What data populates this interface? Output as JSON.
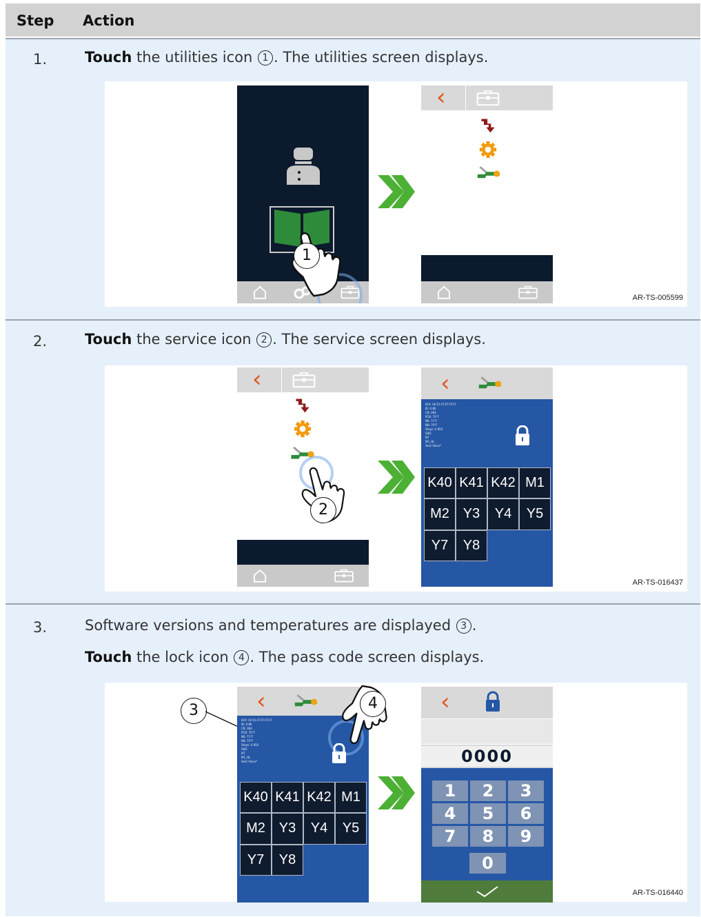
{
  "header": {
    "step": "Step",
    "action": "Action"
  },
  "steps": [
    {
      "number": "1.",
      "action_bold": "Touch",
      "action_text": "the utilities icon",
      "callout": "1",
      "action_rest": ". The utilities screen displays.",
      "ref": "AR-TS-005599"
    },
    {
      "number": "2.",
      "action_bold": "Touch",
      "action_text": "the service icon",
      "callout": "2",
      "action_rest": ". The service screen displays.",
      "ref": "AR-TS-016437"
    },
    {
      "number": "3.",
      "line1_text": "Software versions and temperatures are displayed",
      "line1_callout": "3",
      "line1_rest": ".",
      "action_bold": "Touch",
      "action_text": "the lock icon",
      "callout": "4",
      "action_rest": ". The pass code screen displays.",
      "ref": "AR-TS-016440"
    }
  ],
  "service_screen": {
    "info_text": "ID#: 0A:51:FF:FF:FF:FF\nIB: 0.86\nCB: 084\nPCB: 70°F\nN6: 71°F\nN8: 70°F\nSteps: 0 850\nSW1\nN7\nM1_HL\nVent Valve*",
    "buttons": [
      "K40",
      "K41",
      "K42",
      "M1",
      "M2",
      "Y3",
      "Y4",
      "Y5",
      "Y7",
      "Y8"
    ]
  },
  "passcode_screen": {
    "code": "0000",
    "keys": [
      "1",
      "2",
      "3",
      "4",
      "5",
      "6",
      "7",
      "8",
      "9",
      "0"
    ]
  },
  "colors": {
    "header_bg": "#d2d2d2",
    "row_bg": "#e6f0fb",
    "back_arrow": "#e0561b",
    "service_blue": "#2657a5",
    "dark_navy": "#0c1a2d",
    "confirm_green": "#4f7b3b",
    "next_arrow_green": "#4cb035"
  },
  "icons": [
    "utilities-icon",
    "chef-icon",
    "recipe-book-icon",
    "home-icon",
    "drain-icon",
    "settings-gear-icon",
    "service-wrench-icon",
    "lock-icon",
    "touch-hand-icon",
    "next-arrow-icon",
    "checkmark-icon"
  ]
}
